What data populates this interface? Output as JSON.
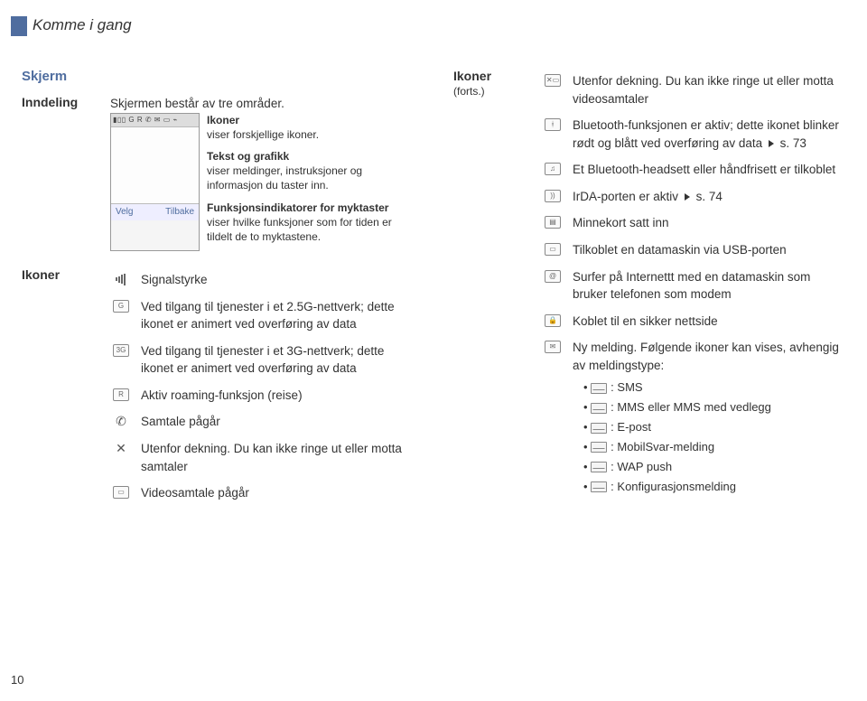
{
  "header": {
    "chapter": "Komme i gang"
  },
  "page_number": "10",
  "left": {
    "title": "Skjerm",
    "layout_label": "Inndeling",
    "layout_intro": "Skjermen består av tre områder.",
    "softkeys": {
      "left": "Velg",
      "right": "Tilbake"
    },
    "callouts": {
      "icons": {
        "head": "Ikoner",
        "body": "viser forskjellige ikoner."
      },
      "text": {
        "head": "Tekst og grafikk",
        "body": "viser meldinger, instruksjoner og informasjon du taster inn."
      },
      "func": {
        "head": "Funksjonsindikatorer for myktaster",
        "body": "viser hvilke funksjoner som for tiden er tildelt de to myktastene."
      }
    },
    "icons_label": "Ikoner",
    "icons": [
      {
        "name": "signal-icon",
        "text": "Signalstyrke"
      },
      {
        "name": "g25-icon",
        "text": "Ved tilgang til tjenester i et 2.5G-nettverk; dette ikonet er animert ved overføring av data"
      },
      {
        "name": "g3-icon",
        "text": "Ved tilgang til tjenester i et 3G-nettverk; dette ikonet er animert ved overføring av data"
      },
      {
        "name": "roaming-icon",
        "text": "Aktiv roaming-funksjon (reise)"
      },
      {
        "name": "call-icon",
        "text": "Samtale pågår"
      },
      {
        "name": "no-service-icon",
        "text": "Utenfor dekning. Du kan ikke ringe ut eller motta samtaler"
      },
      {
        "name": "videocall-icon",
        "text": "Videosamtale pågår"
      }
    ]
  },
  "right": {
    "label": "Ikoner",
    "sublabel": "(forts.)",
    "icons": [
      {
        "name": "no-video-icon",
        "text": "Utenfor dekning. Du kan ikke ringe ut eller motta videosamtaler"
      },
      {
        "name": "bluetooth-icon",
        "text": "Bluetooth-funksjonen er aktiv; dette ikonet blinker rødt og blått ved overføring av data",
        "ref": "s. 73"
      },
      {
        "name": "bt-headset-icon",
        "text": "Et Bluetooth-headsett eller håndfrisett er tilkoblet"
      },
      {
        "name": "irda-icon",
        "text": "IrDA-porten er aktiv",
        "ref": "s. 74"
      },
      {
        "name": "memcard-icon",
        "text": "Minnekort satt inn"
      },
      {
        "name": "usb-icon",
        "text": "Tilkoblet en datamaskin via USB-porten"
      },
      {
        "name": "internet-icon",
        "text": "Surfer på Internettt med en datamaskin som bruker telefonen som modem"
      },
      {
        "name": "secure-icon",
        "text": "Koblet til en sikker nettside"
      },
      {
        "name": "new-message-icon",
        "text": "Ny melding. Følgende ikoner kan vises, avhengig av meldingstype:"
      }
    ],
    "message_types": [
      ": SMS",
      ": MMS eller MMS med vedlegg",
      ": E-post",
      ": MobilSvar-melding",
      ": WAP push",
      ": Konfigurasjonsmelding"
    ]
  }
}
